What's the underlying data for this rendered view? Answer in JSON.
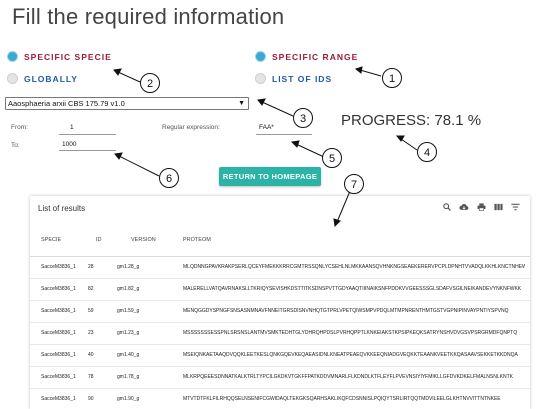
{
  "title": "Fill the required information",
  "options": {
    "specific_specie": "SPECIFIC SPECIE",
    "globally": "GLOBALLY",
    "specific_range": "SPECIFIC RANGE",
    "list_of_ids": "LIST OF IDS"
  },
  "species_select": {
    "value": "Aaosphaeria arxii CBS 175.79 v1.0"
  },
  "range": {
    "from_label": "From:",
    "from_value": "1",
    "to_label": "To:",
    "to_value": "1000"
  },
  "regex": {
    "label": "Regular expression:",
    "value": "FAA*"
  },
  "progress": {
    "text": "PROGRESS: 78.1 %",
    "value": 78.1
  },
  "return_button": "RETURN TO HOMEPAGE",
  "callouts": [
    "1",
    "2",
    "3",
    "4",
    "5",
    "6",
    "7"
  ],
  "results": {
    "title": "List of results",
    "toolbar_icons": [
      "search-icon",
      "cloud-download-icon",
      "print-icon",
      "view-columns-icon",
      "filter-icon"
    ],
    "columns": [
      "SPECIE",
      "ID",
      "VERSION",
      "PROTEOM"
    ],
    "rows": [
      [
        "SacceM3836_1",
        "28",
        "gm1.28_g",
        "MLQDNNGPAVKRAKPSERLQCEYFMEKKKRRCGMTRSSQNLYCSEHLNLMKKAANSQVHNKNGSEAEKERERVPCPLDPNHTVVADQLKKHLKNCTNHEW"
      ],
      [
        "SacceM3836_1",
        "82",
        "gm1.82_g",
        "MALERELLVATQAVRNAKSLLTKRIQYSEVISHKDSTTITKSDNSPVTTGDYAAQTIIINAIKSNFPDDKVVGEESSSGLSDAFVSGILNEIKANDEVYNKNFWKK"
      ],
      [
        "SacceM3836_1",
        "59",
        "gm1.59_g",
        "MENQGGDYSPNGFSNSASNMNAVFNNEITGRSDISNVNHQTGTPRLVPETQIWSMPVPDQLMTMPNRENTHMTGSTVGPNIPINVAYPNTIYSPVNQ"
      ],
      [
        "SacceM3836_1",
        "23",
        "gm1.23_g",
        "MSSSSSSSESSPNLSRSNSLANTMVSMKTEDHTGLYDHRQHPDSLPVRHQPPTLKNKEIAKSTKPSIPKEQKSATRYNSHVDVGSVPSRGRMDFQNPTQ"
      ],
      [
        "SacceM3836_1",
        "40",
        "gm1.40_g",
        "MSEIQNKAETAAQDVQQKLEETKESLQNKGQEVKEQAEASIDNLKNEATPEAEQVKKEEQNIADGVEQKKTEAANKVEETKKQASAAVSEKKETKKDNQA"
      ],
      [
        "SacceM3836_1",
        "78",
        "gm1.78_g",
        "MLKRPQEEESDNNATKALKTRLTYPCILGKDKVTGKFFPATKDDVMNARLFLKDNDLKTFLEYFLPVEVNSIYIYFMIKLLGFDVKDKELFMALNSNLKNTK"
      ],
      [
        "SacceM3836_1",
        "90",
        "gm1.90_g",
        "MTVTDTFKLFILRHQQSELNSENIFCGWIDAQLTEKGKSQARHSAKLIKQFCDSNNISLPQIQYTSRLIRTQQTMDVILEELGLKHTNVVITTNTNKEE"
      ]
    ]
  }
}
